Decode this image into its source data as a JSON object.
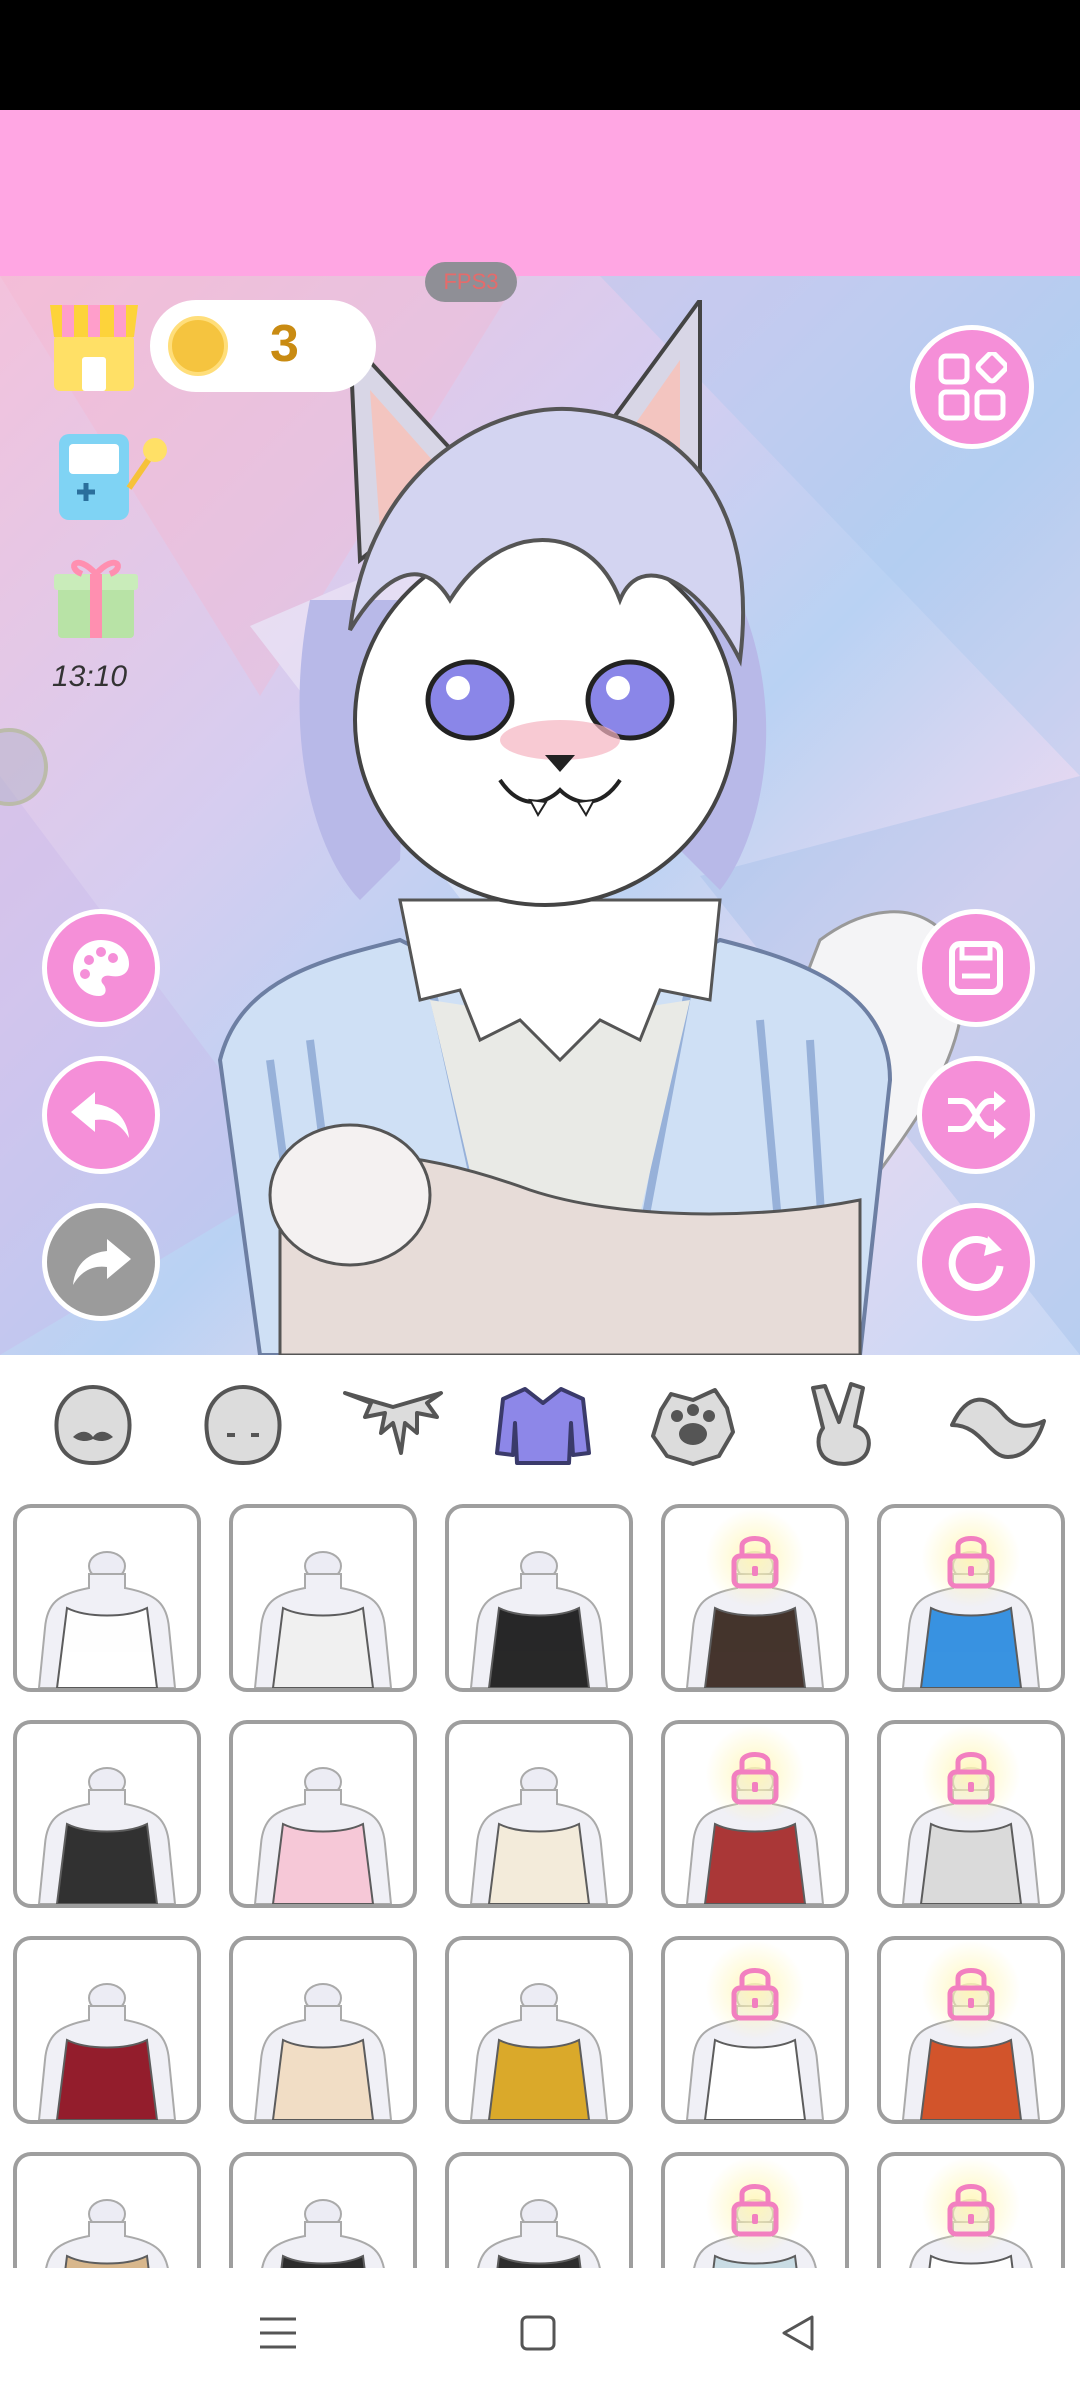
{
  "hud": {
    "fps_label": "FPS3",
    "coins": "3",
    "timer": "13:10"
  },
  "colors": {
    "banner": "#ffa6e3",
    "accent": "#f58fd8",
    "coin": "#f5c43f"
  },
  "left_buttons": [
    {
      "name": "palette-button",
      "icon": "palette-icon"
    },
    {
      "name": "undo-button",
      "icon": "undo-arrow-icon"
    },
    {
      "name": "redo-button",
      "icon": "redo-arrow-icon",
      "disabled": true
    }
  ],
  "right_buttons": [
    {
      "name": "menu-button",
      "icon": "grid-menu-icon"
    },
    {
      "name": "save-button",
      "icon": "save-icon"
    },
    {
      "name": "randomize-button",
      "icon": "shuffle-icon"
    },
    {
      "name": "reset-button",
      "icon": "reset-icon"
    }
  ],
  "category_tabs": [
    {
      "name": "face-tab",
      "icon": "face-mustache-icon"
    },
    {
      "name": "head-tab",
      "icon": "head-icon"
    },
    {
      "name": "fur-tab",
      "icon": "fur-tuft-icon"
    },
    {
      "name": "clothing-tab",
      "icon": "sweater-icon",
      "selected": true
    },
    {
      "name": "accessory-tab",
      "icon": "paw-badge-icon"
    },
    {
      "name": "pose-tab",
      "icon": "peace-hand-icon"
    },
    {
      "name": "tail-tab",
      "icon": "tail-icon"
    }
  ],
  "clothing_items": [
    {
      "name": "white-jacket-paw-shirt",
      "locked": false,
      "color": "#ffffff"
    },
    {
      "name": "sling-bag-outfit",
      "locked": false,
      "color": "#f0f0f0"
    },
    {
      "name": "black-tshirt-panda",
      "locked": false,
      "color": "#1d1d1d"
    },
    {
      "name": "kimono-vest",
      "locked": true,
      "color": "#3b2a22"
    },
    {
      "name": "blue-hoodie",
      "locked": true,
      "color": "#2f8ee0"
    },
    {
      "name": "black-crop-top",
      "locked": false,
      "color": "#262626"
    },
    {
      "name": "pink-crop-top",
      "locked": false,
      "color": "#f7c6d6"
    },
    {
      "name": "cream-wrap-top",
      "locked": false,
      "color": "#f3ead8"
    },
    {
      "name": "red-qipao-top",
      "locked": true,
      "color": "#a62d2d"
    },
    {
      "name": "gray-vest-jeans",
      "locked": true,
      "color": "#d9d9d9"
    },
    {
      "name": "red-scarf",
      "locked": false,
      "color": "#8e1121"
    },
    {
      "name": "fur-collar",
      "locked": false,
      "color": "#f2dcc3"
    },
    {
      "name": "golden-collar",
      "locked": false,
      "color": "#d8a51f"
    },
    {
      "name": "silver-necklace",
      "locked": true,
      "color": "#ffffff"
    },
    {
      "name": "orange-vest",
      "locked": true,
      "color": "#d04b20"
    },
    {
      "name": "tan-coat",
      "locked": false,
      "color": "#d6b486"
    },
    {
      "name": "black-vest",
      "locked": false,
      "color": "#222222"
    },
    {
      "name": "black-tank",
      "locked": false,
      "color": "#222222"
    },
    {
      "name": "denim-outfit",
      "locked": true,
      "color": "#c7dbe3"
    },
    {
      "name": "white-basic",
      "locked": true,
      "color": "#ffffff"
    }
  ]
}
